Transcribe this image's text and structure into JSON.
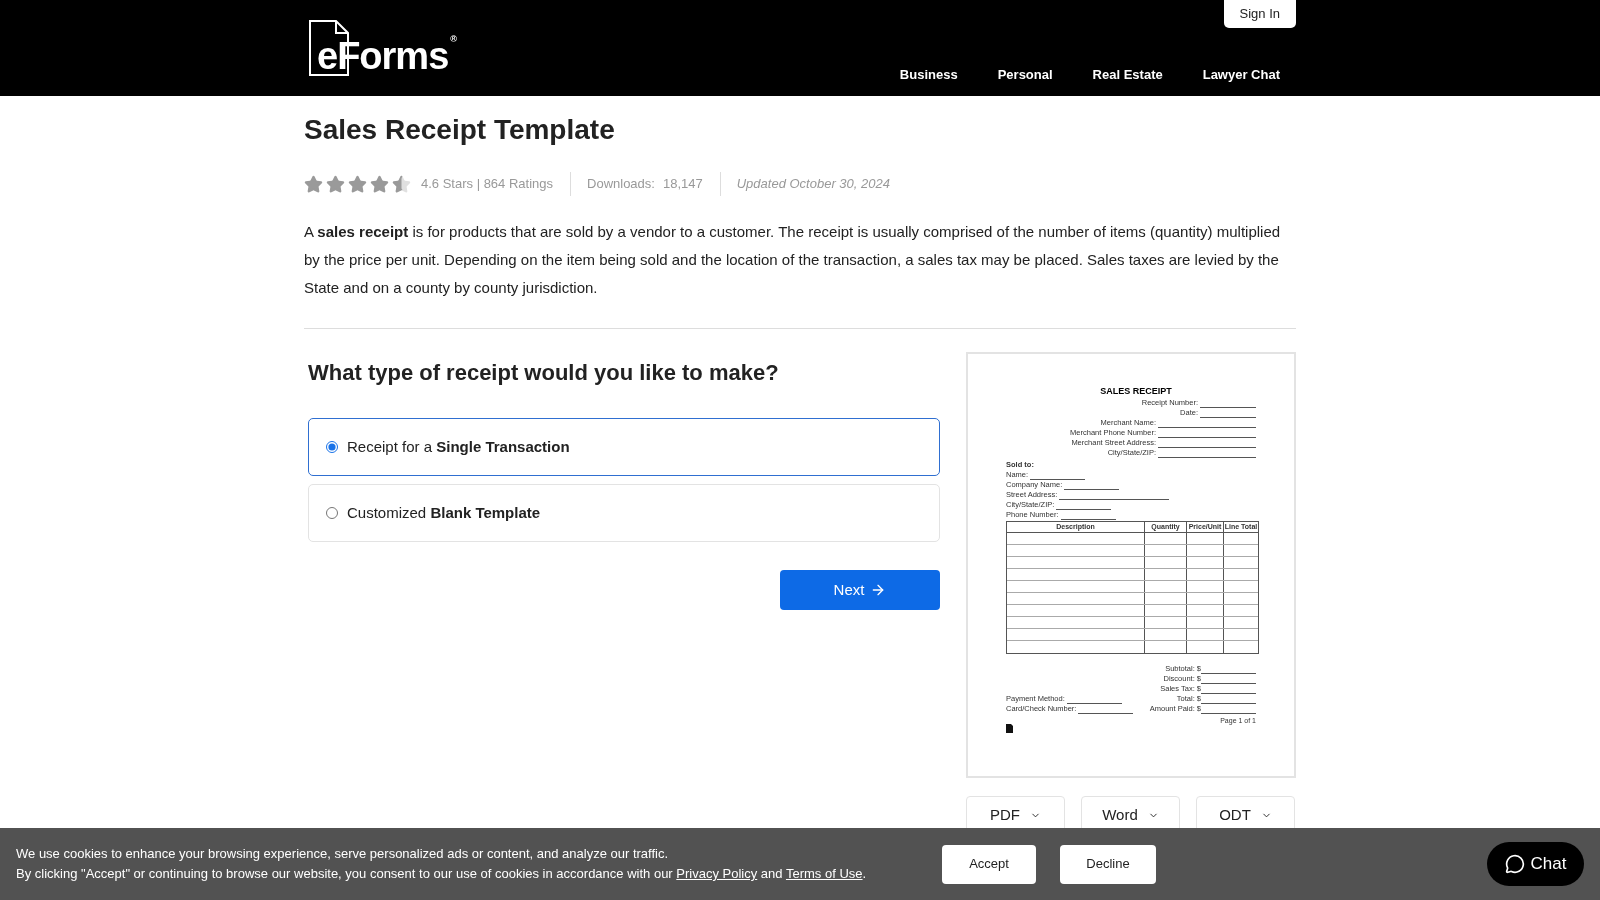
{
  "header": {
    "logo": "eForms",
    "logo_mark": "®",
    "sign_in": "Sign In",
    "nav": [
      "Business",
      "Personal",
      "Real Estate",
      "Lawyer Chat"
    ]
  },
  "title": "Sales Receipt Template",
  "rating": {
    "stars": 4.5,
    "text": "4.6 Stars | 864 Ratings",
    "downloads_label": "Downloads:",
    "downloads": "18,147",
    "updated": "Updated October 30, 2024"
  },
  "description": "A **sales receipt** is for products that are sold by a vendor to a customer. The receipt is usually comprised of the number of items (quantity) multiplied by the price per unit. Depending on the item being sold and the location of the transaction, a sales tax may be placed. Sales taxes are levied by the State and on a county by county jurisdiction.",
  "question": "What type of receipt would you like to make?",
  "options": [
    {
      "label": "Receipt for a **Single Transaction**",
      "selected": true
    },
    {
      "label": "Customized **Blank Template**",
      "selected": false
    }
  ],
  "next_button": "Next",
  "preview": {
    "title": "SALES RECEIPT",
    "header_fields": [
      "Receipt Number:",
      "Date:",
      "Merchant Name:",
      "Merchant Phone Number:",
      "Merchant Street Address:",
      "City/State/ZIP:"
    ],
    "sold_to": "Sold to:",
    "sold_fields": [
      "Name:",
      "Company Name:",
      "Street Address:",
      "City/State/ZIP:",
      "Phone Number:"
    ],
    "columns": [
      "Description",
      "Quantity",
      "Price/Unit",
      "Line Total"
    ],
    "totals": [
      "Subtotal: $",
      "Discount: $",
      "Sales Tax: $",
      "Total: $",
      "Amount Paid: $"
    ],
    "payment_fields": [
      "Payment Method:",
      "Card/Check Number:"
    ],
    "page": "Page 1 of 1"
  },
  "formats": [
    "PDF",
    "Word",
    "ODT"
  ],
  "cookie": {
    "line1": "We use cookies to enhance your browsing experience, serve personalized ads or content, and analyze our traffic.",
    "line2_before": "By clicking \"Accept\" or continuing to browse our website, you consent to our use of cookies in accordance with our",
    "privacy": "Privacy Policy",
    "and": "and",
    "terms": "Terms of Use",
    "end": ".",
    "accept": "Accept",
    "decline": "Decline"
  },
  "chat": "Chat"
}
